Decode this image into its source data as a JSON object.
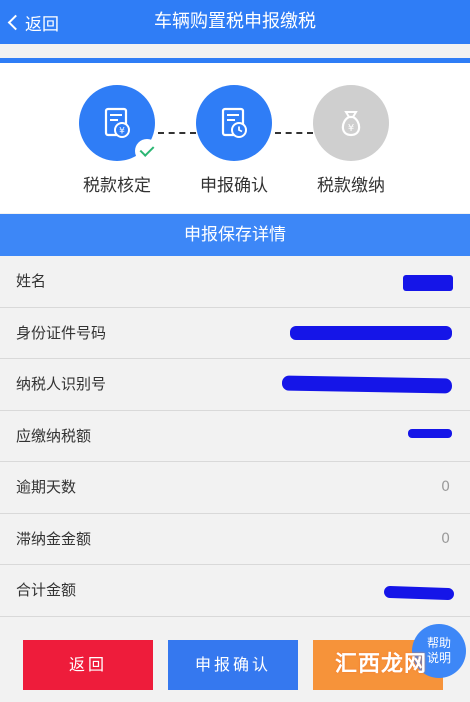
{
  "header": {
    "back_label": "返回",
    "title": "车辆购置税申报缴税"
  },
  "steps": [
    {
      "label": "税款核定",
      "icon": "document-yen-icon",
      "state": "done"
    },
    {
      "label": "申报确认",
      "icon": "document-clock-icon",
      "state": "active"
    },
    {
      "label": "税款缴纳",
      "icon": "money-bag-icon",
      "state": "pending"
    }
  ],
  "section": {
    "title": "申报保存详情"
  },
  "rows": [
    {
      "label": "姓名",
      "value": ""
    },
    {
      "label": "身份证件号码",
      "value": ""
    },
    {
      "label": "纳税人识别号",
      "value": ""
    },
    {
      "label": "应缴纳税额",
      "value": ""
    },
    {
      "label": "逾期天数",
      "value": "0"
    },
    {
      "label": "滞纳金金额",
      "value": "0"
    },
    {
      "label": "合计金额",
      "value": ""
    }
  ],
  "buttons": {
    "back": "返回",
    "confirm": "申报确认",
    "third": ""
  },
  "help": {
    "line1": "帮助",
    "line2": "说明"
  },
  "watermark": "汇西龙网",
  "colors": {
    "primary": "#2f7df6",
    "danger": "#ee1c3b",
    "warning": "#f6933a",
    "redaction": "#1515e8"
  }
}
